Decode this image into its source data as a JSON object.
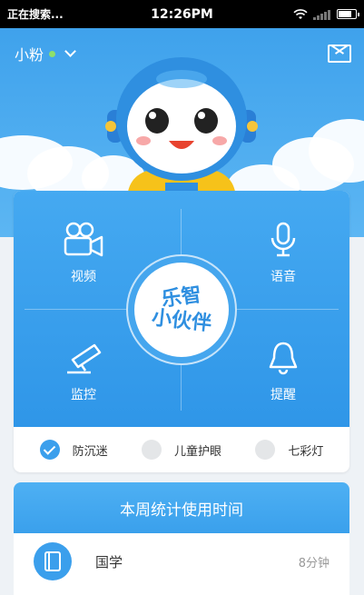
{
  "status_bar": {
    "carrier_text": "正在搜索...",
    "time": "12:26PM"
  },
  "header": {
    "user_name": "小粉",
    "online_color": "#8ee06a",
    "mail_icon": "mail-icon"
  },
  "panel": {
    "center_logo_line1": "乐智",
    "center_logo_line2": "小伙伴",
    "functions": [
      {
        "label": "视频",
        "icon": "video-camera-icon"
      },
      {
        "label": "语音",
        "icon": "microphone-icon"
      },
      {
        "label": "监控",
        "icon": "surveillance-camera-icon"
      },
      {
        "label": "提醒",
        "icon": "bell-icon"
      }
    ],
    "options": [
      {
        "label": "防沉迷",
        "checked": true
      },
      {
        "label": "儿童护眼",
        "checked": false
      },
      {
        "label": "七彩灯",
        "checked": false
      }
    ]
  },
  "stats": {
    "title": "本周统计使用时间",
    "rows": [
      {
        "subject": "国学",
        "duration": "8分钟",
        "icon": "book-icon"
      }
    ]
  },
  "colors": {
    "accent": "#3b9fec",
    "panel_top": "#45a9f1",
    "panel_bottom": "#2f96e8"
  }
}
